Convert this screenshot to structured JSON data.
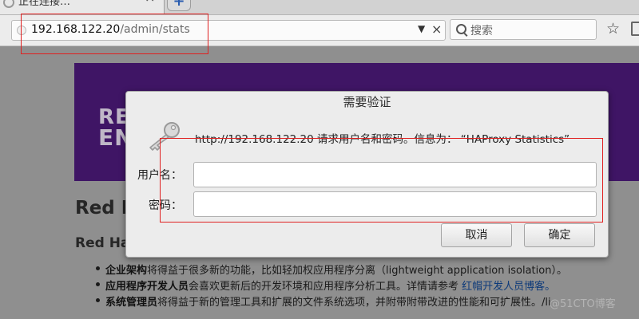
{
  "tab": {
    "title": "正在连接…",
    "close": "×",
    "new_tab": "+"
  },
  "urlbar": {
    "host": "192.168.122.20",
    "path": "/admin/stats",
    "dropdown": "▼",
    "stop": "×"
  },
  "search": {
    "placeholder": "搜索"
  },
  "toolbar": {
    "star": "☆"
  },
  "page": {
    "banner_line1": "RE",
    "banner_line2": "EN",
    "heading1": "Red H",
    "heading2": "Red Ha",
    "bullets": [
      {
        "bold": "企业架构",
        "text": "将得益于很多新的功能，比如轻加权应用程序分离（lightweight application isolation）。",
        "link": ""
      },
      {
        "bold": "应用程序开发人员",
        "text": "会喜欢更新后的开发环境和应用程序分析工具。详情请参考 ",
        "link": "红帽开发人员博客。"
      },
      {
        "bold": "系统管理员",
        "text": "将得益于新的管理工具和扩展的文件系统选项，并附带附带改进的性能和可扩展性。/li",
        "link": ""
      }
    ],
    "watermark": "@51CTO博客"
  },
  "dialog": {
    "title": "需要验证",
    "message": "http://192.168.122.20 请求用户名和密码。信息为：  “HAProxy Statistics”",
    "username_label": "用户名：",
    "password_label": "密码：",
    "username_value": "",
    "password_value": "",
    "cancel_label": "取消",
    "ok_label": "确定"
  },
  "colors": {
    "banner": "#3f1565",
    "annotation": "#e02020",
    "dialog_bg": "#ececec"
  },
  "icons": {
    "tab_loading": "spinner-icon",
    "url_site": "globe-icon",
    "search": "search-icon",
    "bookmark_star": "star-icon",
    "bookmarks": "bookmarks-icon",
    "dialog": "key-icon"
  }
}
